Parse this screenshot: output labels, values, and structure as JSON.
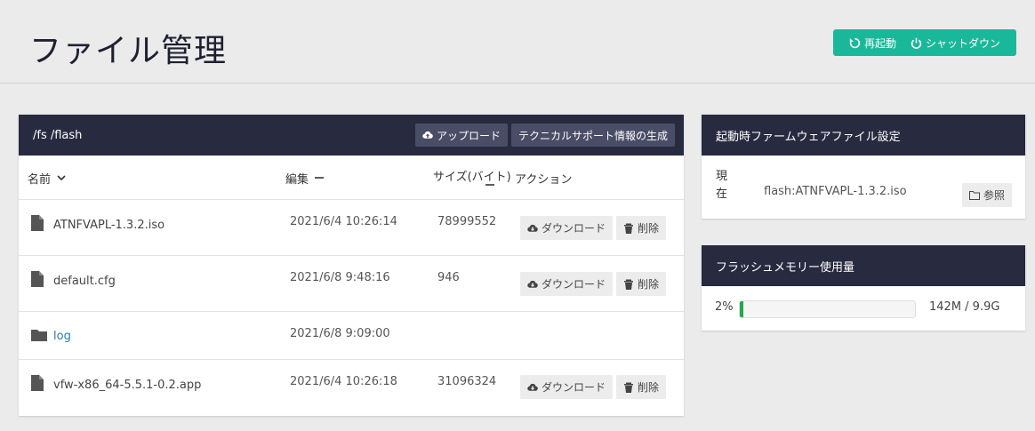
{
  "page": {
    "title": "ファイル管理"
  },
  "system": {
    "restart_label": "再起動",
    "shutdown_label": "シャットダウン"
  },
  "files": {
    "path": "/fs /flash",
    "upload_label": "アップロード",
    "tech_support_label": "テクニカルサポート情報の生成",
    "columns": {
      "name": "名前",
      "edit": "編集",
      "size": "サイズ(バイト)",
      "action": "アクション"
    },
    "rows": [
      {
        "type": "file",
        "name": "ATNFVAPL-1.3.2.iso",
        "date": "2021/6/4 10:26:14",
        "size": "78999552",
        "download": "ダウンロード",
        "delete": "削除"
      },
      {
        "type": "file",
        "name": "default.cfg",
        "date": "2021/6/8 9:48:16",
        "size": "946",
        "download": "ダウンロード",
        "delete": "削除"
      },
      {
        "type": "folder",
        "name": "log",
        "date": "2021/6/8 9:09:00",
        "size": ""
      },
      {
        "type": "file",
        "name": "vfw-x86_64-5.5.1-0.2.app",
        "date": "2021/6/4 10:26:18",
        "size": "31096324",
        "download": "ダウンロード",
        "delete": "削除"
      }
    ]
  },
  "firmware": {
    "title": "起動時ファームウェアファイル設定",
    "label": "現在",
    "value": "flash:ATNFVAPL-1.3.2.iso",
    "browse_label": "参照"
  },
  "memory": {
    "title": "フラッシュメモリー使用量",
    "percent_label": "2%",
    "percent": 2,
    "total": "142M / 9.9G"
  },
  "colors": {
    "accent": "#1ab89a",
    "header_bg": "#282a40",
    "bar_fill": "#22a94a",
    "link": "#2a7ab8"
  }
}
